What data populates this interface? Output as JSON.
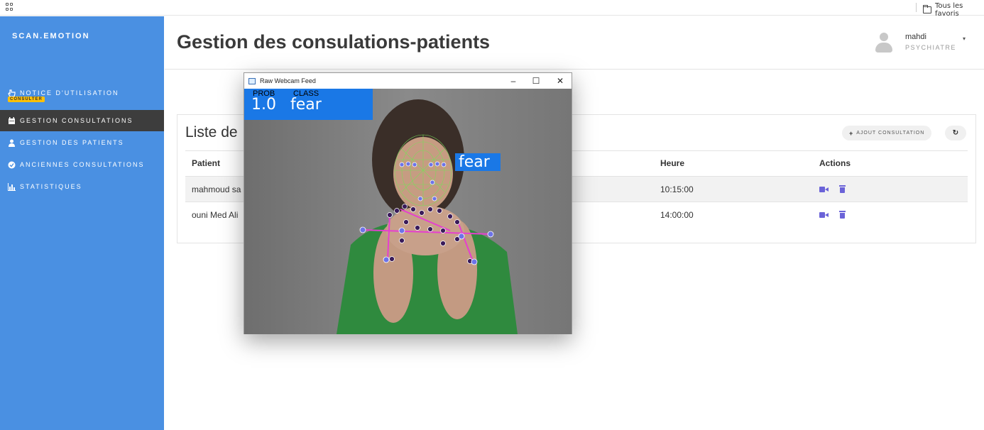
{
  "browser": {
    "bookmark_folder": "Tous les favoris"
  },
  "sidebar": {
    "brand": "SCAN.EMOTION",
    "badge": "CONSULTER",
    "items": [
      {
        "label": "NOTICE D'UTILISATION",
        "icon": "hand-pointer-icon"
      },
      {
        "label": "GESTION CONSULTATIONS",
        "icon": "calendar-icon",
        "active": true
      },
      {
        "label": "GESTION DES PATIENTS",
        "icon": "user-icon"
      },
      {
        "label": "ANCIENNES CONSULTATIONS",
        "icon": "check-circle-icon"
      },
      {
        "label": "STATISTIQUES",
        "icon": "bar-chart-icon"
      }
    ]
  },
  "header": {
    "title": "Gestion des consulations-patients",
    "user_name": "mahdi",
    "user_role": "PSYCHIATRE"
  },
  "card": {
    "title": "Liste de",
    "add_button": "AJOUT CONSULTATION",
    "columns": [
      "Patient",
      "Heure",
      "Actions"
    ],
    "rows": [
      {
        "patient": "mahmoud sa",
        "heure": "10:15:00"
      },
      {
        "patient": "ouni Med Ali",
        "heure": "14:00:00"
      }
    ]
  },
  "webcam": {
    "window_title": "Raw Webcam Feed",
    "prob_label": "PROB",
    "class_label": "CLASS",
    "prob_value": "1.0",
    "class_value": "fear",
    "face_label": "fear"
  },
  "colors": {
    "sidebar": "#4a90e2",
    "active_item": "#3d3d3d",
    "badge": "#ffc107",
    "action_icons": "#6b63d8",
    "hud": "#1a78e6"
  }
}
